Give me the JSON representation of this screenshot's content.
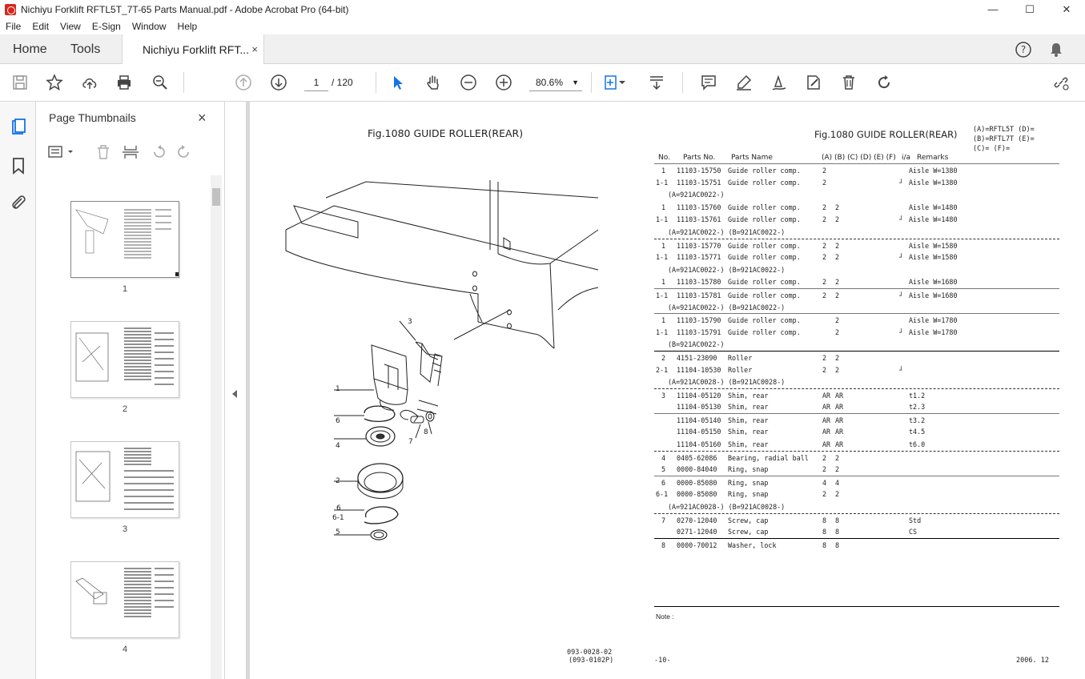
{
  "window": {
    "title": "Nichiyu Forklift RFTL5T_7T-65 Parts Manual.pdf - Adobe Acrobat Pro (64-bit)",
    "minimize": "—",
    "maximize": "☐",
    "close": "✕"
  },
  "menu": [
    "File",
    "Edit",
    "View",
    "E-Sign",
    "Window",
    "Help"
  ],
  "tabs": {
    "home": "Home",
    "tools": "Tools",
    "document": "Nichiyu Forklift RFT...",
    "document_close": "×"
  },
  "toolbar": {
    "current_page": "1",
    "total_pages": "/ 120",
    "zoom": "80.6%"
  },
  "thumbnails": {
    "title": "Page Thumbnails",
    "close": "×",
    "pages": [
      "1",
      "2",
      "3",
      "4"
    ]
  },
  "document": {
    "fig_title_left": "Fig.1080  GUIDE ROLLER(REAR)",
    "fig_title_right": "Fig.1080  GUIDE ROLLER(REAR)",
    "model_codes": [
      "(A)=RFTL5T (D)=",
      "(B)=RFTL7T (E)=",
      "(C)=          (F)="
    ],
    "headers": {
      "no": "No.",
      "parts_no": "Parts No.",
      "parts_name": "Parts Name",
      "cols": "(A) (B) (C) (D) (E) (F)",
      "ia": "i/a",
      "remarks": "Remarks"
    },
    "rows": [
      {
        "no": "1",
        "pn": "11103-15750",
        "name": "Guide roller comp.",
        "a": "2",
        "b": "",
        "ia": "",
        "rem": "Aisle W=1380",
        "line": "hsolid"
      },
      {
        "no": "1-1",
        "pn": "11103-15751",
        "name": "Guide roller comp.",
        "a": "2",
        "b": "",
        "ia": "┘",
        "rem": "Aisle W=1380",
        "line": ""
      },
      {
        "no": "",
        "pn": "(A=921AC0022-)",
        "name": "",
        "a": "",
        "b": "",
        "ia": "",
        "rem": "",
        "line": ""
      },
      {
        "no": "1",
        "pn": "11103-15760",
        "name": "Guide roller comp.",
        "a": "2",
        "b": "2",
        "ia": "",
        "rem": "Aisle W=1480",
        "line": ""
      },
      {
        "no": "1-1",
        "pn": "11103-15761",
        "name": "Guide roller comp.",
        "a": "2",
        "b": "2",
        "ia": "┘",
        "rem": "Aisle W=1480",
        "line": ""
      },
      {
        "no": "",
        "pn": "(A=921AC0022-) (B=921AC0022-)",
        "name": "",
        "a": "",
        "b": "",
        "ia": "",
        "rem": "",
        "line": ""
      },
      {
        "no": "1",
        "pn": "11103-15770",
        "name": "Guide roller comp.",
        "a": "2",
        "b": "2",
        "ia": "",
        "rem": "Aisle W=1580",
        "line": "hdash"
      },
      {
        "no": "1-1",
        "pn": "11103-15771",
        "name": "Guide roller comp.",
        "a": "2",
        "b": "2",
        "ia": "┘",
        "rem": "Aisle W=1580",
        "line": ""
      },
      {
        "no": "",
        "pn": "(A=921AC0022-) (B=921AC0022-)",
        "name": "",
        "a": "",
        "b": "",
        "ia": "",
        "rem": "",
        "line": ""
      },
      {
        "no": "1",
        "pn": "11103-15780",
        "name": "Guide roller comp.",
        "a": "2",
        "b": "2",
        "ia": "",
        "rem": "Aisle W=1680",
        "line": ""
      },
      {
        "no": "1-1",
        "pn": "11103-15781",
        "name": "Guide roller comp.",
        "a": "2",
        "b": "2",
        "ia": "┘",
        "rem": "Aisle W=1680",
        "line": "hsolid"
      },
      {
        "no": "",
        "pn": "(A=921AC0022-) (B=921AC0022-)",
        "name": "",
        "a": "",
        "b": "",
        "ia": "",
        "rem": "",
        "line": ""
      },
      {
        "no": "1",
        "pn": "11103-15790",
        "name": "Guide roller comp.",
        "a": "",
        "b": "2",
        "ia": "",
        "rem": "Aisle W=1780",
        "line": "hsolid"
      },
      {
        "no": "1-1",
        "pn": "11103-15791",
        "name": "Guide roller comp.",
        "a": "",
        "b": "2",
        "ia": "┘",
        "rem": "Aisle W=1780",
        "line": ""
      },
      {
        "no": "",
        "pn": "(B=921AC0022-)",
        "name": "",
        "a": "",
        "b": "",
        "ia": "",
        "rem": "",
        "line": ""
      },
      {
        "no": "2",
        "pn": "4151-23090",
        "name": "Roller",
        "a": "2",
        "b": "2",
        "ia": "",
        "rem": "",
        "line": "hrule"
      },
      {
        "no": "2-1",
        "pn": "11104-10530",
        "name": "Roller",
        "a": "2",
        "b": "2",
        "ia": "┘",
        "rem": "",
        "line": ""
      },
      {
        "no": "",
        "pn": "(A=921AC0028-) (B=921AC0028-)",
        "name": "",
        "a": "",
        "b": "",
        "ia": "",
        "rem": "",
        "line": ""
      },
      {
        "no": "3",
        "pn": "11104-05120",
        "name": "Shim, rear",
        "a": "AR",
        "b": "AR",
        "ia": "",
        "rem": "t1.2",
        "line": "hdash"
      },
      {
        "no": "",
        "pn": "11104-05130",
        "name": "Shim, rear",
        "a": "AR",
        "b": "AR",
        "ia": "",
        "rem": "t2.3",
        "line": ""
      },
      {
        "no": "",
        "pn": "11104-05140",
        "name": "Shim, rear",
        "a": "AR",
        "b": "AR",
        "ia": "",
        "rem": "t3.2",
        "line": "hsolid"
      },
      {
        "no": "",
        "pn": "11104-05150",
        "name": "Shim, rear",
        "a": "AR",
        "b": "AR",
        "ia": "",
        "rem": "t4.5",
        "line": ""
      },
      {
        "no": "",
        "pn": "11104-05160",
        "name": "Shim, rear",
        "a": "AR",
        "b": "AR",
        "ia": "",
        "rem": "t6.0",
        "line": ""
      },
      {
        "no": "4",
        "pn": "0405-62086",
        "name": "Bearing, radial ball",
        "a": "2",
        "b": "2",
        "ia": "",
        "rem": "",
        "line": "hdash"
      },
      {
        "no": "5",
        "pn": "0000-84040",
        "name": "Ring, snap",
        "a": "2",
        "b": "2",
        "ia": "",
        "rem": "",
        "line": ""
      },
      {
        "no": "6",
        "pn": "0000-85080",
        "name": "Ring, snap",
        "a": "4",
        "b": "4",
        "ia": "",
        "rem": "",
        "line": "hsolid"
      },
      {
        "no": "6-1",
        "pn": "0000-85080",
        "name": "Ring, snap",
        "a": "2",
        "b": "2",
        "ia": "",
        "rem": "",
        "line": ""
      },
      {
        "no": "",
        "pn": "(A=921AC0028-) (B=921AC0028-)",
        "name": "",
        "a": "",
        "b": "",
        "ia": "",
        "rem": "",
        "line": ""
      },
      {
        "no": "7",
        "pn": "0270-12040",
        "name": "Screw, cap",
        "a": "8",
        "b": "8",
        "ia": "",
        "rem": "Std",
        "line": "hdash"
      },
      {
        "no": "",
        "pn": "0271-12040",
        "name": "Screw, cap",
        "a": "8",
        "b": "8",
        "ia": "",
        "rem": "CS",
        "line": ""
      },
      {
        "no": "8",
        "pn": "0000-70012",
        "name": "Washer, lock",
        "a": "8",
        "b": "8",
        "ia": "",
        "rem": "",
        "line": "hrule"
      }
    ],
    "note": "Note :",
    "footer_code1": "093-0028-02",
    "footer_code2": "(093-0102P)",
    "footer_page": "-10-",
    "footer_date": "2006. 12",
    "callouts": [
      "3",
      "1",
      "6",
      "4",
      "2",
      "6",
      "6-1",
      "5",
      "7",
      "8"
    ]
  }
}
